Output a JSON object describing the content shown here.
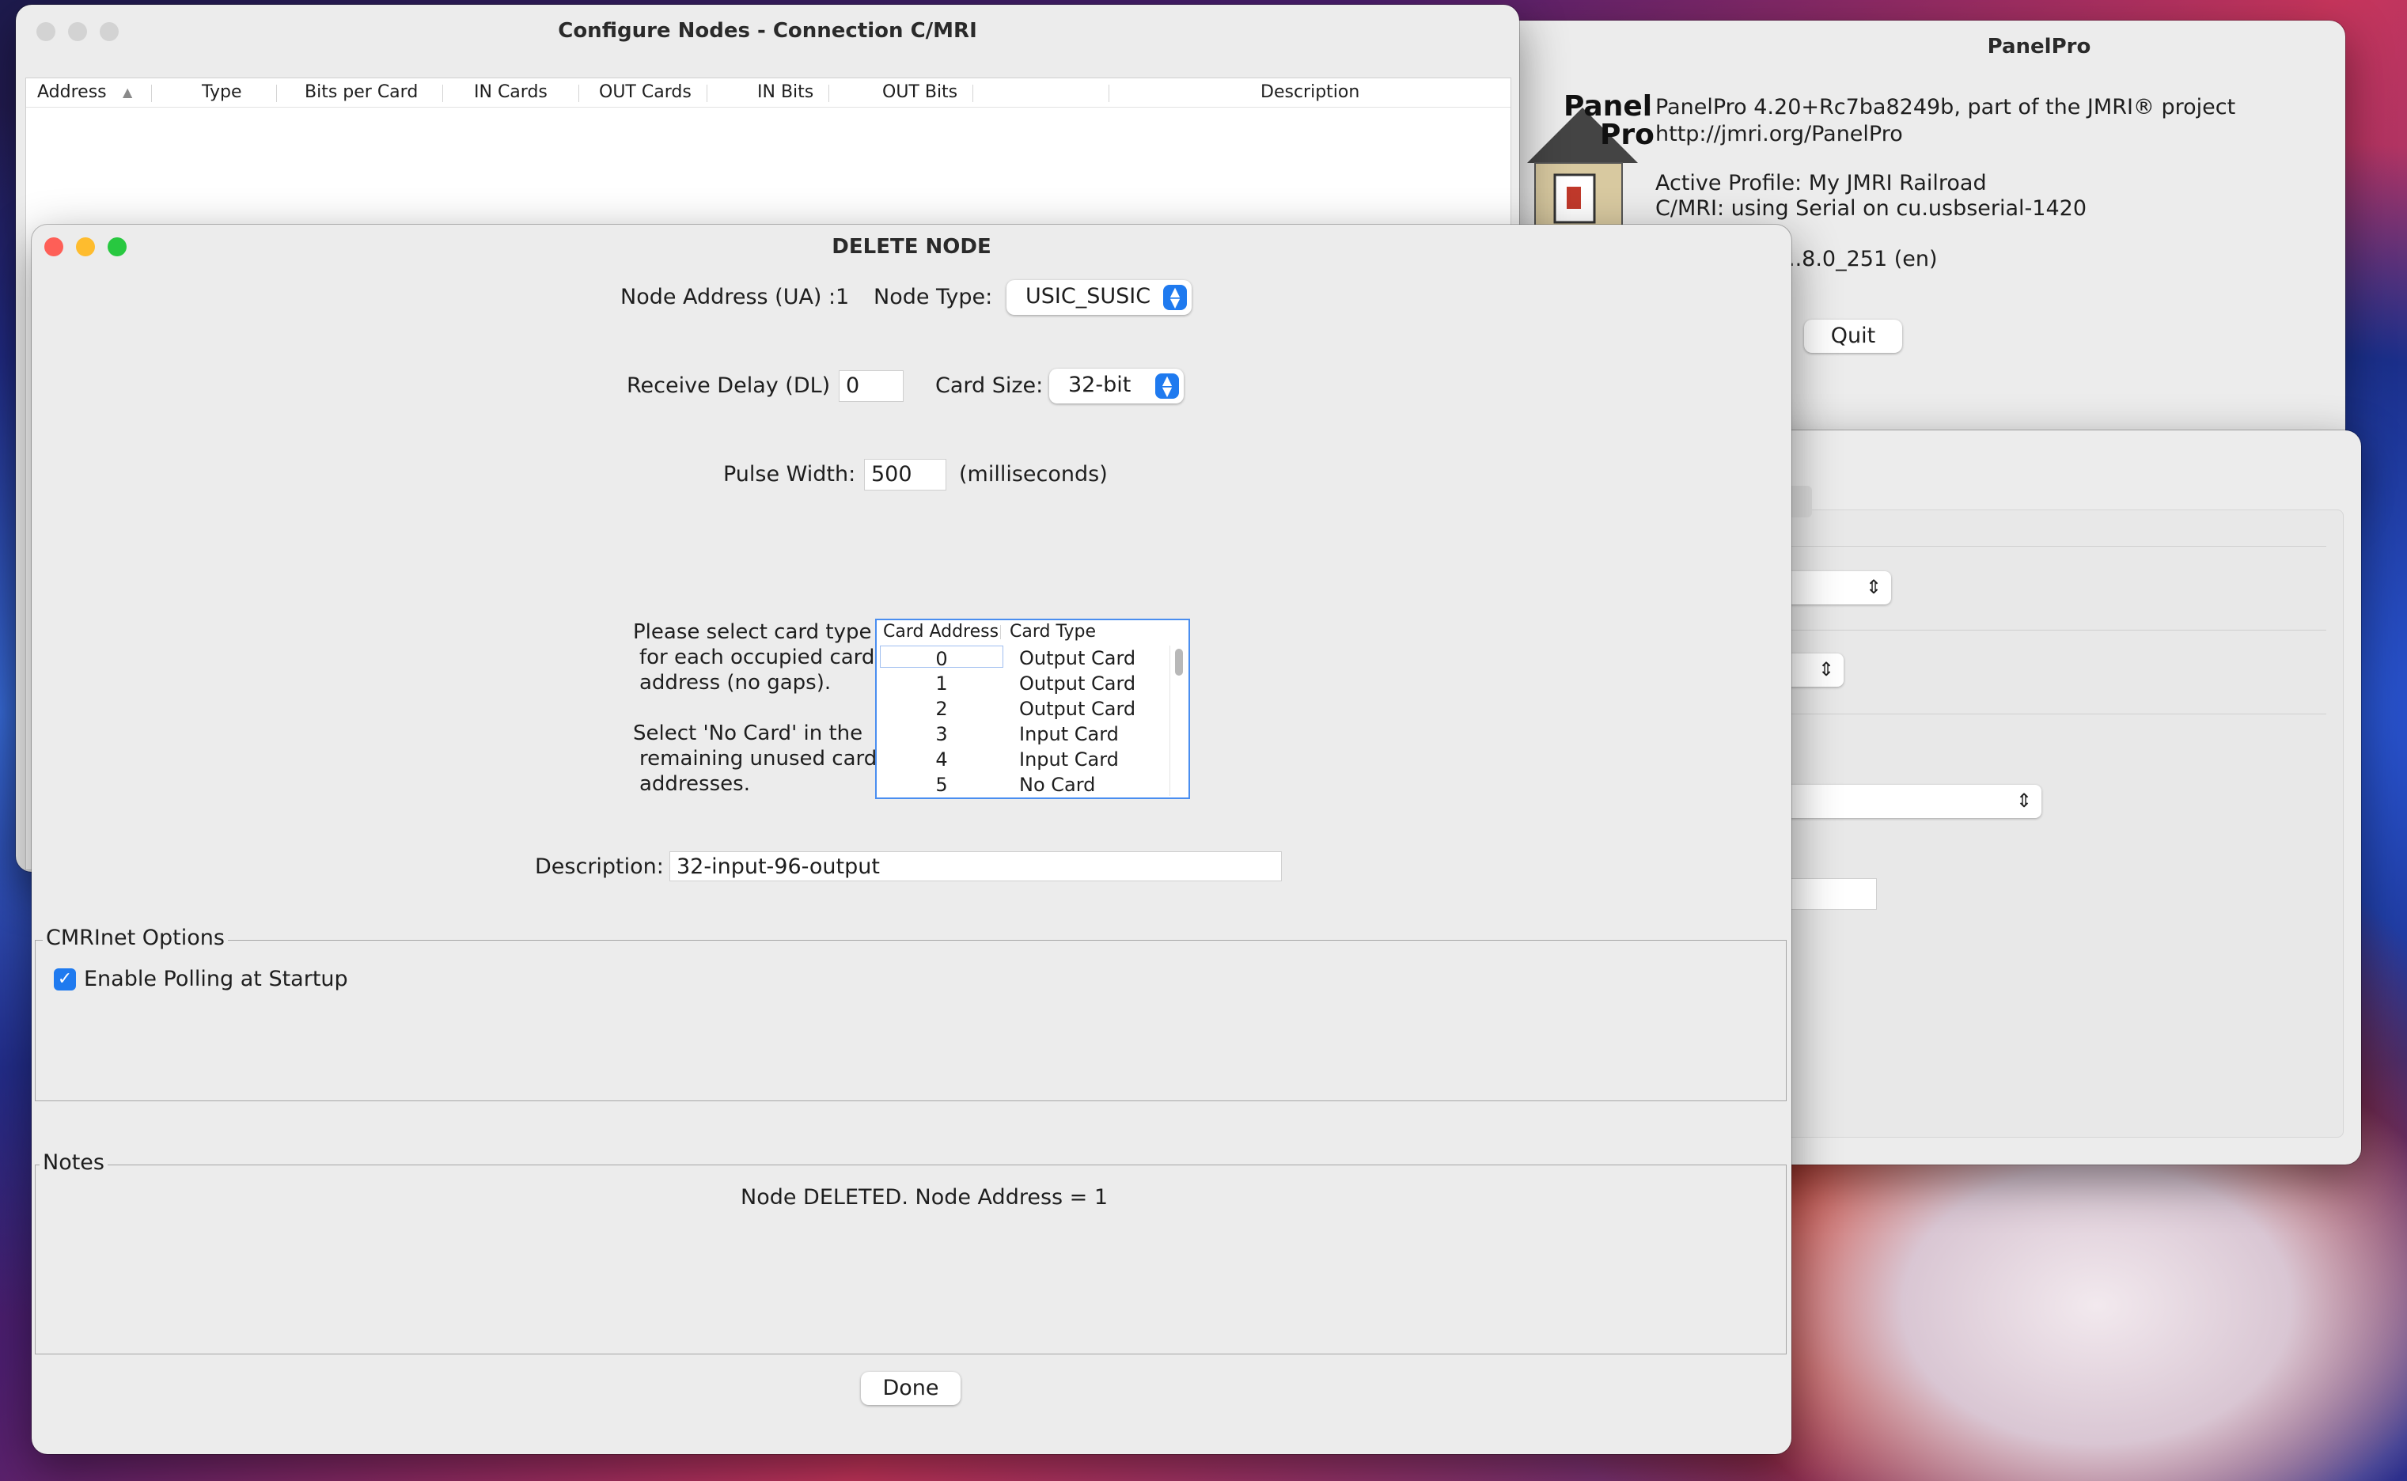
{
  "configure_window": {
    "title": "Configure Nodes - Connection C/MRI",
    "columns": [
      "Address",
      "Type",
      "Bits per Card",
      "IN Cards",
      "OUT Cards",
      "IN Bits",
      "OUT Bits",
      "Description"
    ],
    "sort_indicator": "▲"
  },
  "panelpro_window": {
    "title": "PanelPro",
    "logo_line1": "Panel",
    "logo_line2": "Pro",
    "version_line": "PanelPro 4.20+Rc7ba8249b, part of the JMRI® project",
    "url": "http://jmri.org/PanelPro",
    "profile": "Active Profile: My JMRI Railroad",
    "connection": "C/MRI: using Serial on cu.usbserial-1420",
    "java": "..8.0_251 (en)",
    "quit_label": "Quit"
  },
  "delete_dialog": {
    "title": "DELETE NODE",
    "node_address_label": "Node Address (UA) :",
    "node_address_value": "1",
    "node_type_label": "Node Type:",
    "node_type_value": "USIC_SUSIC",
    "receive_delay_label": "Receive Delay (DL) :",
    "receive_delay_value": "0",
    "card_size_label": "Card Size:",
    "card_size_value": "32-bit",
    "pulse_width_label": "Pulse Width:",
    "pulse_width_value": "500",
    "pulse_width_unit": "(milliseconds)",
    "instructions_1": [
      "Please select card type",
      "for each occupied card",
      "address (no gaps)."
    ],
    "instructions_2": [
      "Select 'No Card' in the",
      "remaining unused card",
      "addresses."
    ],
    "card_table": {
      "headers": [
        "Card Address",
        "Card Type"
      ],
      "rows": [
        {
          "address": "0",
          "type": "Output Card"
        },
        {
          "address": "1",
          "type": "Output Card"
        },
        {
          "address": "2",
          "type": "Output Card"
        },
        {
          "address": "3",
          "type": "Input Card"
        },
        {
          "address": "4",
          "type": "Input Card"
        },
        {
          "address": "5",
          "type": "No Card"
        }
      ]
    },
    "description_label": "Description:",
    "description_value": "32-input-96-output",
    "cmrinet_title": "CMRInet Options",
    "polling_label": "Enable Polling at Startup",
    "polling_checked": true,
    "notes_title": "Notes",
    "notes_text": "Node DELETED. Node Address = 1",
    "done_label": "Done"
  },
  "colors": {
    "accent": "#1f7aef",
    "close": "#fe5f57",
    "minimize": "#febc2e",
    "zoom": "#28c840"
  }
}
